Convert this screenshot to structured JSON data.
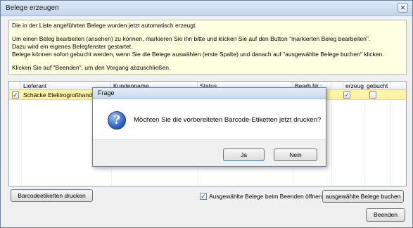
{
  "window": {
    "title": "Belege erzeugen",
    "close_glyph": "✕"
  },
  "info": {
    "lines": [
      "Die in der Liste angeführten Belege wurden jetzt automatisch erzeugt.",
      "Um einen Beleg bearbeiten (ansehen) zu können, markieren Sie ihn bitte und klicken Sie auf den Button \"markierten Beleg bearbeiten\".",
      "Dazu wird ein eigenes Belegfenster gestartet.",
      "Belege können sofort gebucht werden, wenn Sie die Belege auswählen (erste Spalte) und danach auf \"ausgewählte Belege buchen\" klicken.",
      "Klicken Sie auf \"Beenden\", um den Vorgang abzuschließen."
    ]
  },
  "grid": {
    "columns": [
      "Lieferant",
      "Kundenname",
      "Status",
      "Bearb.Nr.:",
      "erzeugt",
      "gebucht"
    ],
    "rows": [
      {
        "selected": true,
        "lieferant": "Schäcke Elektrogroßhandel",
        "kundenname": "",
        "status": "",
        "bearb_nr": "",
        "erzeugt": true,
        "gebucht": false
      }
    ]
  },
  "footer": {
    "barcode_button": "Barcodeetiketten drucken",
    "open_on_exit_label": "Ausgewählte Belege beim Beenden öffnen",
    "open_on_exit_checked": true,
    "book_button": "ausgewählte Belege buchen",
    "exit_button": "Beenden"
  },
  "dialog": {
    "title": "Frage",
    "icon": "question-icon",
    "message": "Möchten Sie die vorbereiteten Barcode-Etiketten jetzt drucken?",
    "yes_label": "Ja",
    "no_label": "Nein"
  },
  "colors": {
    "info_background": "#ffffe1",
    "selected_row": "#fff3a8",
    "window_background": "#f0f0f0"
  }
}
